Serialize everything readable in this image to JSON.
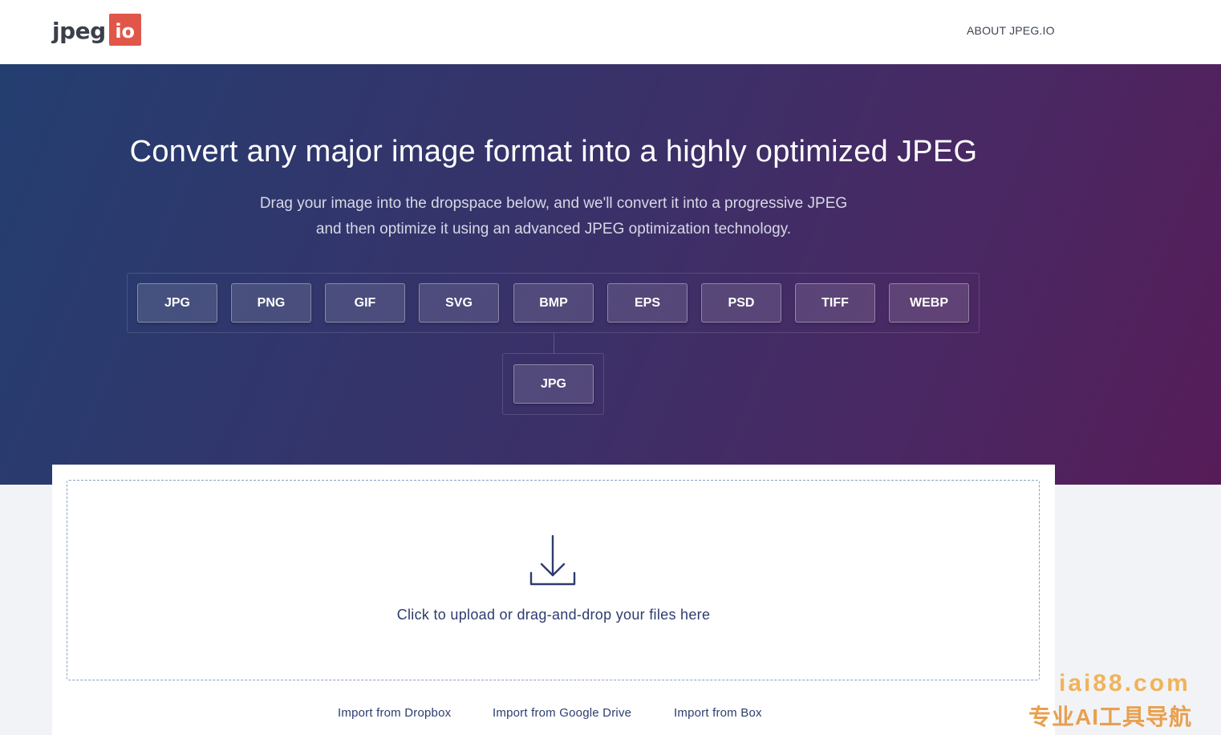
{
  "header": {
    "logo_text": "jpeg",
    "logo_badge": "io",
    "about_link": "ABOUT JPEG.IO"
  },
  "hero": {
    "title": "Convert any major image format into a highly optimized JPEG",
    "subtitle_line1": "Drag your image into the dropspace below, and we'll convert it into a progressive JPEG",
    "subtitle_line2": "and then optimize it using an advanced JPEG optimization technology.",
    "formats": [
      "JPG",
      "PNG",
      "GIF",
      "SVG",
      "BMP",
      "EPS",
      "PSD",
      "TIFF",
      "WEBP"
    ],
    "target_format": "JPG"
  },
  "upload": {
    "icon": "download-icon",
    "prompt": "Click to upload or drag-and-drop your files here",
    "import_dropbox": "Import from Dropbox",
    "import_gdrive": "Import from Google Drive",
    "import_box": "Import from Box"
  },
  "watermark": {
    "line1": "iai88.com",
    "line2": "专业AI工具导航"
  },
  "colors": {
    "accent": "#e0574a",
    "hero_start": "#243e70",
    "hero_end": "#561c58",
    "text_dark": "#2d3c6e"
  }
}
